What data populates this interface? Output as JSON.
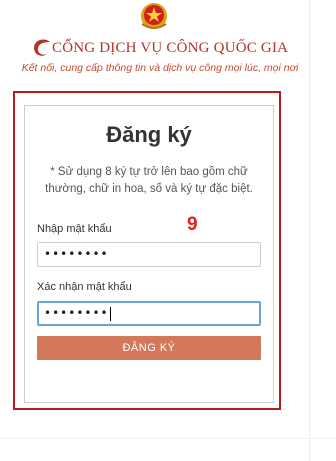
{
  "header": {
    "title": "CỔNG DỊCH VỤ CÔNG QUỐC GIA",
    "tagline": "Kết nối, cung cấp thông tin và dịch vụ công mọi lúc, mọi nơi",
    "emblem_icon": "national-emblem-icon",
    "logo_icon": "swirl-logo-icon",
    "brand_color": "#b5312b"
  },
  "form": {
    "heading": "Đăng ký",
    "note": "* Sử dụng 8 ký tự trở lên bao gồm chữ thường, chữ in hoa, số và ký tự đặc biệt.",
    "password_label": "Nhập mật khẩu",
    "password_value": "••••••••",
    "confirm_label": "Xác nhận mật khẩu",
    "confirm_value": "••••••••",
    "submit_label": "ĐĂNG KÝ",
    "button_color": "#d3785a"
  },
  "annotation": {
    "step": "9",
    "highlight_color": "#b81d1d"
  }
}
